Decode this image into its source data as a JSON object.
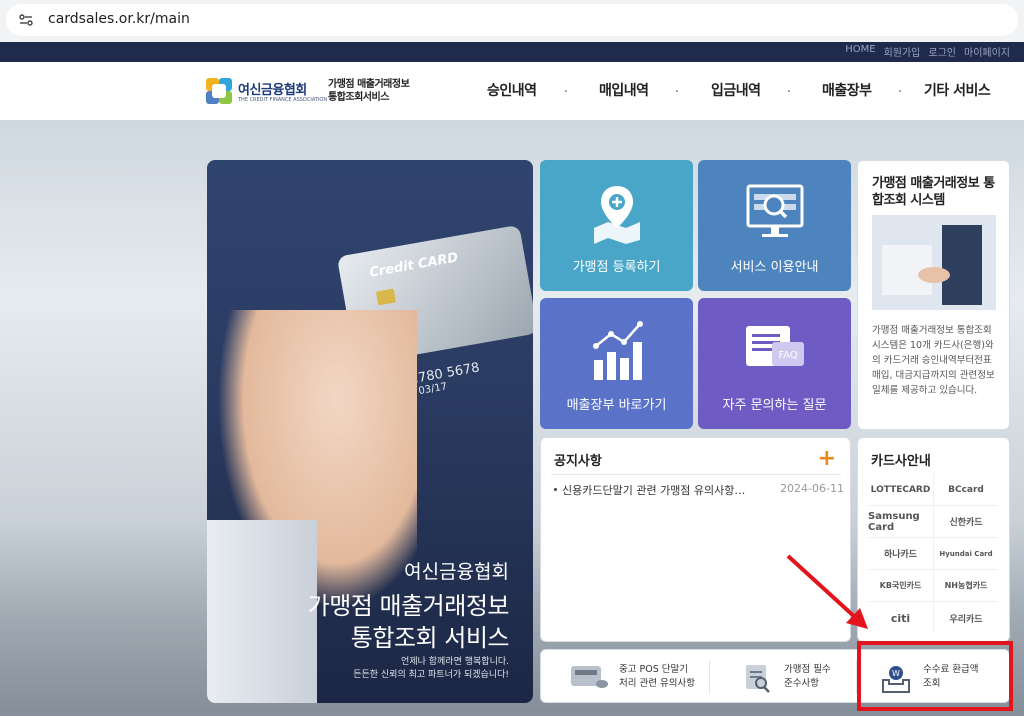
{
  "browser": {
    "url": "cardsales.or.kr/main"
  },
  "util": {
    "links": [
      "HOME",
      "회원가입",
      "로그인",
      "마이페이지"
    ]
  },
  "header": {
    "logo_name": "여신금융협회",
    "logo_sub": "THE CREDIT FINANCE ASSOCIATION",
    "service_line1": "가맹점 매출거래정보",
    "service_line2": "통합조회서비스",
    "nav": [
      "승인내역",
      "매입내역",
      "입금내역",
      "매출장부",
      "기타 서비스"
    ]
  },
  "hero": {
    "card_label": "Credit CARD",
    "card_number": "123 2961 2780 5678",
    "card_valid": "VALID 03/17",
    "line1": "여신금융협회",
    "line2": "가맹점 매출거래정보",
    "line3": "통합조회 서비스",
    "tagline1": "언제나 함께라면 행복합니다.",
    "tagline2": "든든한 신뢰의 최고 파트너가 되겠습니다!"
  },
  "tiles": [
    {
      "label": "가맹점 등록하기",
      "color": "#4aa6c8"
    },
    {
      "label": "서비스 이용안내",
      "color": "#4e84be"
    },
    {
      "label": "매출장부 바로가기",
      "color": "#5a73c9"
    },
    {
      "label": "자주 문의하는 질문",
      "color": "#6f5bc4",
      "icon_text": "FAQ"
    }
  ],
  "info": {
    "title": "가맹점 매출거래정보 통합조회 시스템",
    "desc": "가맹점 매출거래정보 통합조회시스템은 10개 카드사(은행)와의 카드거래 승인내역부터전표매입, 대금지급까지의 관련정보 일체를 제공하고 있습니다."
  },
  "notice": {
    "title": "공지사항",
    "more": "+",
    "items": [
      {
        "text": "신용카드단말기 관련 가맹점 유의사항…",
        "date": "2024-06-11"
      }
    ]
  },
  "cards": {
    "title": "카드사안내",
    "companies": [
      "LOTTECARD",
      "BCcard",
      "Samsung Card",
      "신한카드",
      "하나카드",
      "Hyundai Card",
      "KB국민카드",
      "NH농협카드",
      "citi",
      "우리카드"
    ]
  },
  "bottom_links": [
    {
      "line1": "중고 POS 단말기",
      "line2": "처리 관련 유의사항"
    },
    {
      "line1": "가맹점 필수",
      "line2": "준수사항"
    },
    {
      "line1": "수수료 환급액",
      "line2": "조회"
    }
  ],
  "colors": {
    "util_bar": "#1f2a4d",
    "accent": "#e48a1b",
    "highlight": "#e3141b"
  }
}
